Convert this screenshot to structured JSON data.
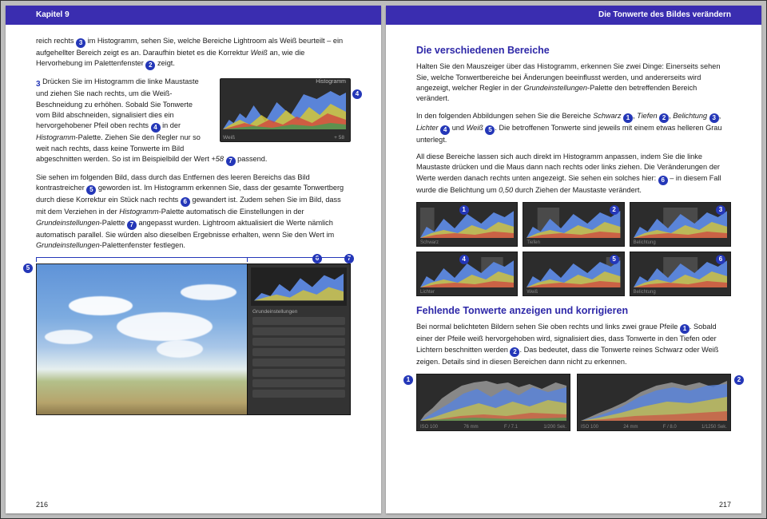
{
  "left": {
    "header": "Kapitel 9",
    "pageno": "216",
    "p1a": "reich rechts ",
    "p1b": " im Histogramm, sehen Sie, welche Bereiche Lightroom als Weiß beurteilt – ein aufgehellter Bereich zeigt es an. Daraufhin bietet es die Korrektur ",
    "p1c": " an, wie die Hervorhebung im Palettenfenster ",
    "p1d": " zeigt.",
    "p1_em": "Weiß",
    "step3_lead": "3",
    "step3a": " Drücken Sie im Histogramm die linke Maustaste und ziehen Sie nach rechts, um die Weiß-Beschneidung zu erhöhen. Sobald Sie Tonwerte vom Bild abschneiden, signalisiert dies ein hervorgehobener Pfeil oben rechts ",
    "step3b": " in der ",
    "step3c": "-Palette. Ziehen Sie den Regler nur so weit nach rechts, dass keine Tonwerte im Bild abgeschnitten werden. So ist im Beispielbild der Wert ",
    "step3d": " ",
    "step3e": " passend.",
    "step3_em1": "Histogramm",
    "step3_val": "+58",
    "p3a": "Sie sehen im folgenden Bild, dass durch das Entfernen des leeren Bereichs das Bild kontrastreicher ",
    "p3b": " geworden ist. Im Histogramm erkennen Sie, dass der gesamte Tonwertberg durch diese Korrektur ein Stück nach rechts ",
    "p3c": " gewandert ist. Zudem sehen Sie im Bild, dass mit dem Verziehen in der ",
    "p3d": "-Palette automatisch die Einstellungen in der ",
    "p3e": "-Palette ",
    "p3f": " angepasst wurden. Lightroom aktualisiert die Werte nämlich automatisch parallel. Sie würden also dieselben Ergebnisse erhalten, wenn Sie den Wert im ",
    "p3g": "-Palettenfenster festlegen.",
    "p3_em1": "Histogramm",
    "p3_em2": "Grundeinstellungen",
    "p3_em3": "Grundeinstellungen",
    "histo_title": "Histogramm",
    "readout_l": "Weiß",
    "readout_r": "+ 58",
    "panel_lbl": "Grundeinstellungen"
  },
  "right": {
    "header": "Die Tonwerte des Bildes verändern",
    "pageno": "217",
    "h1": "Die verschiedenen Bereiche",
    "r1": "Halten Sie den Mauszeiger über das Histogramm, erkennen Sie zwei Dinge: Einerseits sehen Sie, welche Tonwertbereiche bei Änderungen beeinflusst werden, und andererseits wird angezeigt, welcher Regler in der ",
    "r1b": "-Palette den betreffenden Bereich verändert.",
    "r1_em": "Grundeinstellungen",
    "r2a": "In den folgenden Abbildungen sehen Sie die Bereiche ",
    "r2_schwarz": "Schwarz",
    "r2_tief": "Tiefen",
    "r2_bel": "Belichtung",
    "r2_licht": "Lichter",
    "r2_weiss": "Weiß",
    "r2b": ". Die betroffenen Tonwerte sind jeweils mit einem etwas helleren Grau unterlegt.",
    "r3a": "All diese Bereiche lassen sich auch direkt im Histogramm anpassen, indem Sie die linke Maustaste drücken und die Maus dann nach rechts oder links ziehen. Die Veränderungen der Werte werden danach rechts unten angezeigt. Sie sehen ein solches hier: ",
    "r3b": " – in diesem Fall wurde die Belichtung um ",
    "r3c": " durch Ziehen der Maustaste verändert.",
    "r3_val": "0,50",
    "thumb_caps": [
      "Schwarz",
      "Tiefen",
      "Belichtung",
      "Lichter",
      "Weiß",
      "Belichtung"
    ],
    "h2": "Fehlende Tonwerte anzeigen und korrigieren",
    "r4a": "Bei normal belichteten Bildern sehen Sie oben rechts und links zwei graue Pfeile ",
    "r4b": ". Sobald einer der Pfeile weiß hervorgehoben wird, signalisiert dies, dass Tonwerte in den Tiefen oder Lichtern beschnitten werden ",
    "r4c": ". Das bedeutet, dass die Tonwerte reines Schwarz oder Weiß zeigen. Details sind in diesen Bereichen dann nicht zu erkennen.",
    "wide1_meta": [
      "ISO 100",
      "76 mm",
      "F / 7.1",
      "1/200 Sek."
    ],
    "wide2_meta": [
      "ISO 100",
      "24 mm",
      "F / 8.0",
      "1/1250 Sek."
    ]
  },
  "callouts": {
    "n1": "1",
    "n2": "2",
    "n3": "3",
    "n4": "4",
    "n5": "5",
    "n6": "6",
    "n7": "7"
  }
}
